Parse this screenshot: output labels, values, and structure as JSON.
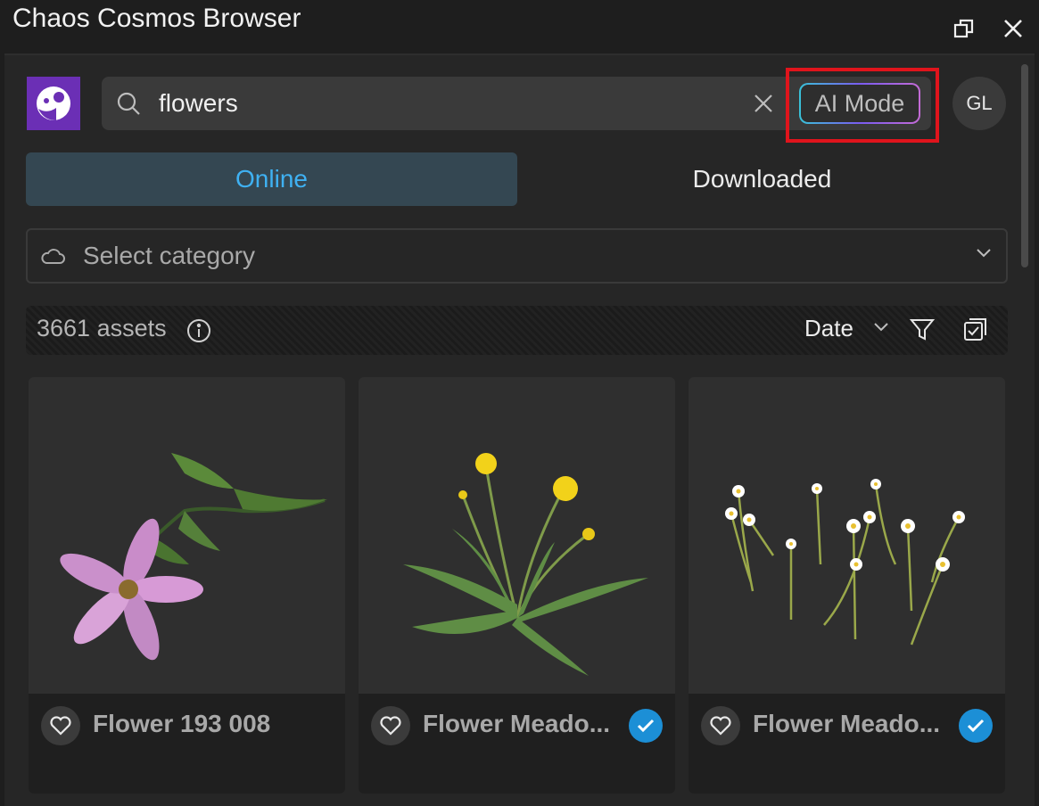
{
  "window": {
    "title": "Chaos Cosmos Browser"
  },
  "search": {
    "value": "flowers",
    "placeholder": "",
    "ai_mode_label": "AI Mode"
  },
  "user": {
    "initials": "GL"
  },
  "tabs": [
    {
      "label": "Online",
      "active": true
    },
    {
      "label": "Downloaded",
      "active": false
    }
  ],
  "category": {
    "placeholder": "Select category"
  },
  "assets": {
    "count_label": "3661 assets",
    "sort_label": "Date"
  },
  "cards": [
    {
      "name": "Flower 193 008",
      "downloaded": false,
      "icon": "pink-flower-thumbnail"
    },
    {
      "name": "Flower Meado...",
      "downloaded": true,
      "icon": "dandelion-thumbnail"
    },
    {
      "name": "Flower Meado...",
      "downloaded": true,
      "icon": "daisy-meadow-thumbnail"
    }
  ],
  "colors": {
    "accent": "#3fb1f2",
    "logo": "#6b2fb5",
    "check": "#1c8fd6",
    "highlight": "#e0141c"
  }
}
